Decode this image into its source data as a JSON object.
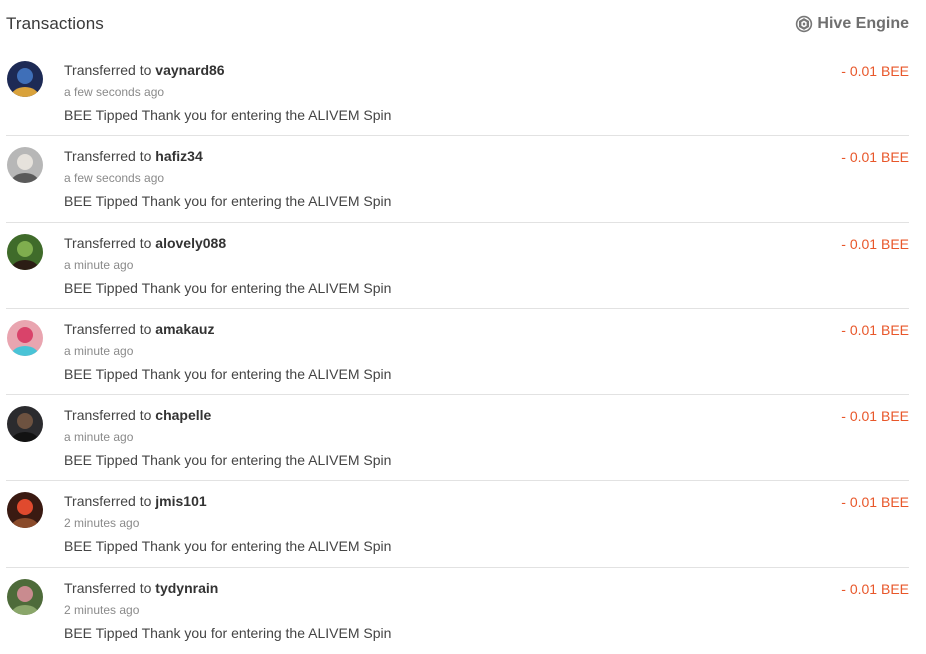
{
  "header": {
    "title": "Transactions",
    "engine_label": "Hive Engine",
    "engine_icon": "hive-engine-icon"
  },
  "colors": {
    "amount": "#e8572a",
    "divider": "#e2e2e2"
  },
  "transactions": [
    {
      "prefix": "Transferred to",
      "user": "vaynard86",
      "time": "a few seconds ago",
      "memo": "BEE Tipped Thank you for entering the ALIVEM Spin",
      "amount": "- 0.01 BEE",
      "avatar_colors": [
        "#1d2a55",
        "#3f6fb8",
        "#d9a23b"
      ]
    },
    {
      "prefix": "Transferred to",
      "user": "hafiz34",
      "time": "a few seconds ago",
      "memo": "BEE Tipped Thank you for entering the ALIVEM Spin",
      "amount": "- 0.01 BEE",
      "avatar_colors": [
        "#b7b7b7",
        "#e6e2dc",
        "#5a5a5a"
      ]
    },
    {
      "prefix": "Transferred to",
      "user": "alovely088",
      "time": "a minute ago",
      "memo": "BEE Tipped Thank you for entering the ALIVEM Spin",
      "amount": "- 0.01 BEE",
      "avatar_colors": [
        "#3f6b2a",
        "#7fae4e",
        "#2b1d14"
      ]
    },
    {
      "prefix": "Transferred to",
      "user": "amakauz",
      "time": "a minute ago",
      "memo": "BEE Tipped Thank you for entering the ALIVEM Spin",
      "amount": "- 0.01 BEE",
      "avatar_colors": [
        "#e9a5b0",
        "#d9436a",
        "#49c3d6"
      ]
    },
    {
      "prefix": "Transferred to",
      "user": "chapelle",
      "time": "a minute ago",
      "memo": "BEE Tipped Thank you for entering the ALIVEM Spin",
      "amount": "- 0.01 BEE",
      "avatar_colors": [
        "#2b2b2e",
        "#6d5240",
        "#121212"
      ]
    },
    {
      "prefix": "Transferred to",
      "user": "jmis101",
      "time": "2 minutes ago",
      "memo": "BEE Tipped Thank you for entering the ALIVEM Spin",
      "amount": "- 0.01 BEE",
      "avatar_colors": [
        "#3a1a12",
        "#e04a2e",
        "#8a4a2a"
      ]
    },
    {
      "prefix": "Transferred to",
      "user": "tydynrain",
      "time": "2 minutes ago",
      "memo": "BEE Tipped Thank you for entering the ALIVEM Spin",
      "amount": "- 0.01 BEE",
      "avatar_colors": [
        "#4e6b3a",
        "#c98b8f",
        "#8aa66a"
      ]
    }
  ]
}
